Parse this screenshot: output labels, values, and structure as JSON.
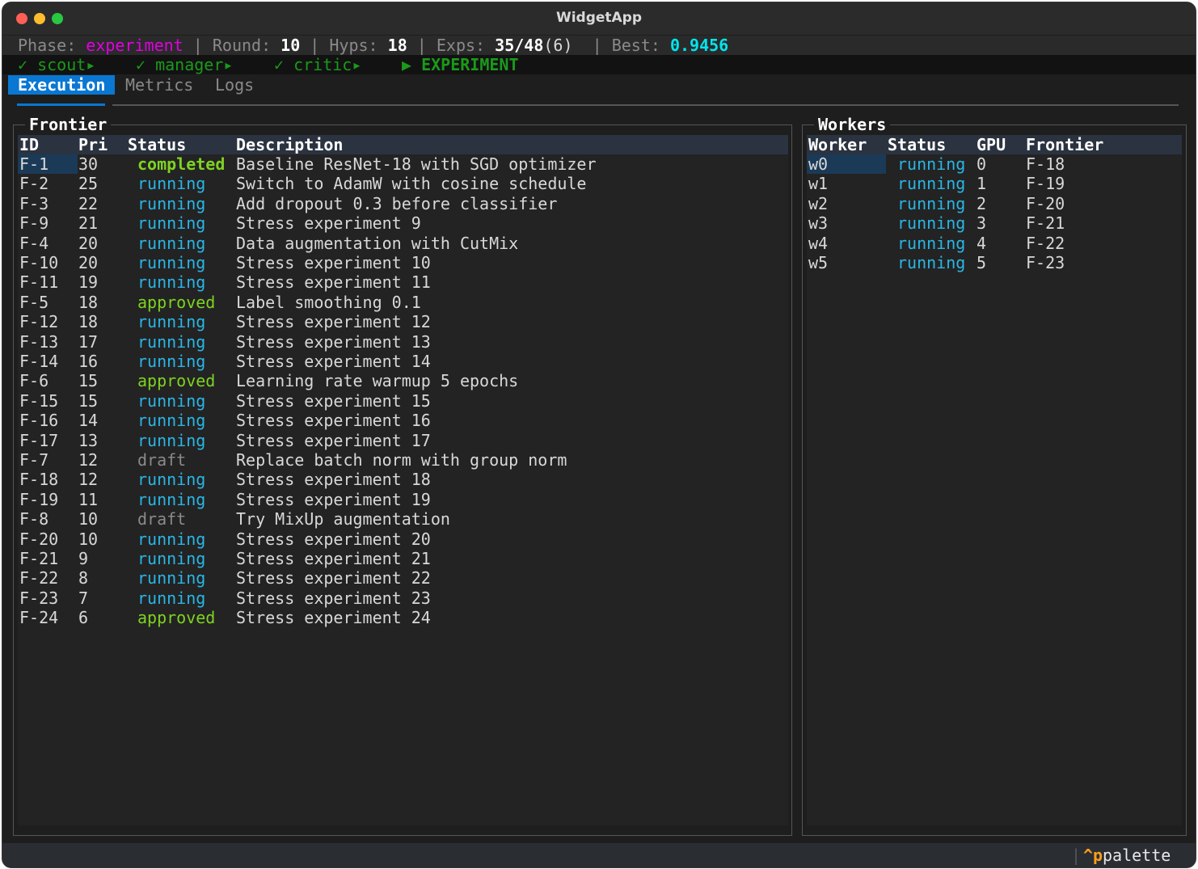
{
  "window": {
    "title": "WidgetApp"
  },
  "status": {
    "phase_label": "Phase:",
    "phase": "experiment",
    "round_label": "Round:",
    "round": "10",
    "hyps_label": "Hyps:",
    "hyps": "18",
    "exps_label": "Exps:",
    "exps": "35/48",
    "exps_extra": "(6)",
    "best_label": "Best:",
    "best": "0.9456",
    "sep": "|"
  },
  "pipeline": [
    {
      "label": "✓ scout▸"
    },
    {
      "label": "✓ manager▸"
    },
    {
      "label": "✓ critic▸"
    },
    {
      "label": "▶ EXPERIMENT"
    }
  ],
  "tabs": [
    {
      "label": "Execution",
      "active": true
    },
    {
      "label": "Metrics",
      "active": false
    },
    {
      "label": "Logs",
      "active": false
    }
  ],
  "frontier": {
    "title": "Frontier",
    "columns": [
      "ID",
      "Pri",
      "Status",
      "Description"
    ],
    "rows": [
      {
        "id": "F-1",
        "pri": "30",
        "status": "completed",
        "desc": "Baseline ResNet-18 with SGD optimizer"
      },
      {
        "id": "F-2",
        "pri": "25",
        "status": "running",
        "desc": "Switch to AdamW with cosine schedule"
      },
      {
        "id": "F-3",
        "pri": "22",
        "status": "running",
        "desc": "Add dropout 0.3 before classifier"
      },
      {
        "id": "F-9",
        "pri": "21",
        "status": "running",
        "desc": "Stress experiment 9"
      },
      {
        "id": "F-4",
        "pri": "20",
        "status": "running",
        "desc": "Data augmentation with CutMix"
      },
      {
        "id": "F-10",
        "pri": "20",
        "status": "running",
        "desc": "Stress experiment 10"
      },
      {
        "id": "F-11",
        "pri": "19",
        "status": "running",
        "desc": "Stress experiment 11"
      },
      {
        "id": "F-5",
        "pri": "18",
        "status": "approved",
        "desc": "Label smoothing 0.1"
      },
      {
        "id": "F-12",
        "pri": "18",
        "status": "running",
        "desc": "Stress experiment 12"
      },
      {
        "id": "F-13",
        "pri": "17",
        "status": "running",
        "desc": "Stress experiment 13"
      },
      {
        "id": "F-14",
        "pri": "16",
        "status": "running",
        "desc": "Stress experiment 14"
      },
      {
        "id": "F-6",
        "pri": "15",
        "status": "approved",
        "desc": "Learning rate warmup 5 epochs"
      },
      {
        "id": "F-15",
        "pri": "15",
        "status": "running",
        "desc": "Stress experiment 15"
      },
      {
        "id": "F-16",
        "pri": "14",
        "status": "running",
        "desc": "Stress experiment 16"
      },
      {
        "id": "F-17",
        "pri": "13",
        "status": "running",
        "desc": "Stress experiment 17"
      },
      {
        "id": "F-7",
        "pri": "12",
        "status": "draft",
        "desc": "Replace batch norm with group norm"
      },
      {
        "id": "F-18",
        "pri": "12",
        "status": "running",
        "desc": "Stress experiment 18"
      },
      {
        "id": "F-19",
        "pri": "11",
        "status": "running",
        "desc": "Stress experiment 19"
      },
      {
        "id": "F-8",
        "pri": "10",
        "status": "draft",
        "desc": "Try MixUp augmentation"
      },
      {
        "id": "F-20",
        "pri": "10",
        "status": "running",
        "desc": "Stress experiment 20"
      },
      {
        "id": "F-21",
        "pri": "9",
        "status": "running",
        "desc": "Stress experiment 21"
      },
      {
        "id": "F-22",
        "pri": "8",
        "status": "running",
        "desc": "Stress experiment 22"
      },
      {
        "id": "F-23",
        "pri": "7",
        "status": "running",
        "desc": "Stress experiment 23"
      },
      {
        "id": "F-24",
        "pri": "6",
        "status": "approved",
        "desc": "Stress experiment 24"
      }
    ]
  },
  "workers": {
    "title": "Workers",
    "columns": [
      "Worker",
      "Status",
      "GPU",
      "Frontier"
    ],
    "rows": [
      {
        "worker": "w0",
        "status": "running",
        "gpu": "0",
        "frontier": "F-18"
      },
      {
        "worker": "w1",
        "status": "running",
        "gpu": "1",
        "frontier": "F-19"
      },
      {
        "worker": "w2",
        "status": "running",
        "gpu": "2",
        "frontier": "F-20"
      },
      {
        "worker": "w3",
        "status": "running",
        "gpu": "3",
        "frontier": "F-21"
      },
      {
        "worker": "w4",
        "status": "running",
        "gpu": "4",
        "frontier": "F-22"
      },
      {
        "worker": "w5",
        "status": "running",
        "gpu": "5",
        "frontier": "F-23"
      }
    ]
  },
  "footer": {
    "sep": "|",
    "key": "^p",
    "label": "palette"
  }
}
